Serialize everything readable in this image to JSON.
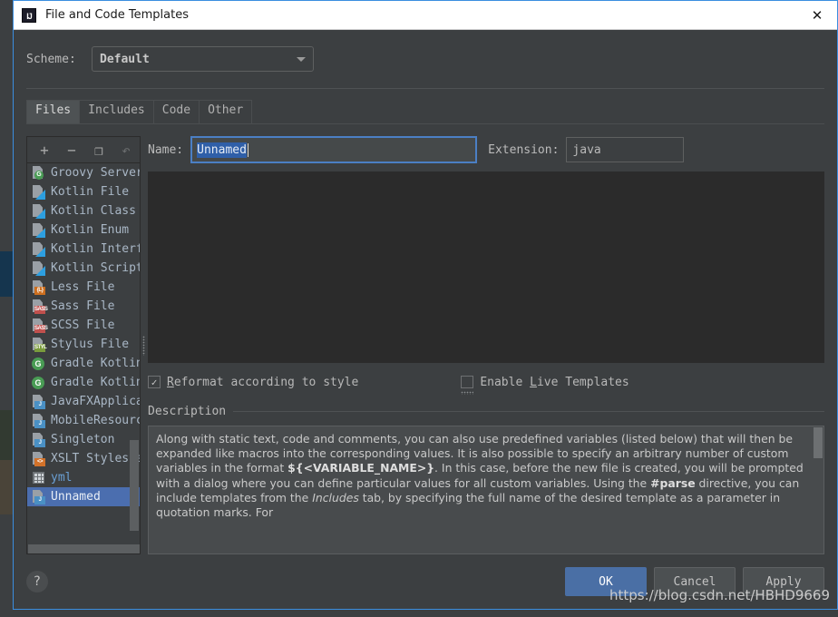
{
  "window": {
    "title": "File and Code Templates",
    "logo_text": "IJ",
    "close_icon": "close-icon"
  },
  "scheme": {
    "label": "Scheme:",
    "value": "Default",
    "caret_icon": "chevron-down-icon"
  },
  "tabs": [
    {
      "label": "Files",
      "active": true
    },
    {
      "label": "Includes",
      "active": false
    },
    {
      "label": "Code",
      "active": false
    },
    {
      "label": "Other",
      "active": false
    }
  ],
  "toolbar": [
    {
      "name": "add-button",
      "glyph": "+",
      "disabled": false
    },
    {
      "name": "remove-button",
      "glyph": "−",
      "disabled": false
    },
    {
      "name": "copy-button",
      "glyph": "❐",
      "disabled": false
    },
    {
      "name": "reset-button",
      "glyph": "↶",
      "disabled": true
    }
  ],
  "template_list": {
    "items": [
      {
        "label": "Groovy Server Page",
        "icon": "groovy-file-icon",
        "kind": "circle",
        "badge": "G",
        "color": "#499c54"
      },
      {
        "label": "Kotlin File",
        "icon": "kotlin-file-icon",
        "kind": "kotlin"
      },
      {
        "label": "Kotlin Class",
        "icon": "kotlin-file-icon",
        "kind": "kotlin"
      },
      {
        "label": "Kotlin Enum",
        "icon": "kotlin-file-icon",
        "kind": "kotlin"
      },
      {
        "label": "Kotlin Interface",
        "icon": "kotlin-file-icon",
        "kind": "kotlin"
      },
      {
        "label": "Kotlin Script",
        "icon": "kotlin-file-icon",
        "kind": "kotlin"
      },
      {
        "label": "Less File",
        "icon": "less-file-icon",
        "kind": "badge",
        "badge": "{L}",
        "color": "#cd6f1f"
      },
      {
        "label": "Sass File",
        "icon": "sass-file-icon",
        "kind": "badge",
        "badge": "SASS",
        "color": "#c0504d"
      },
      {
        "label": "SCSS File",
        "icon": "scss-file-icon",
        "kind": "badge",
        "badge": "SASS",
        "color": "#c0504d"
      },
      {
        "label": "Stylus File",
        "icon": "stylus-file-icon",
        "kind": "badge",
        "badge": "STYL",
        "color": "#7a9b3c"
      },
      {
        "label": "Gradle Kotlin DSL Build Scri",
        "icon": "gradle-icon",
        "kind": "circle",
        "badge": "G",
        "color": "#499c54"
      },
      {
        "label": "Gradle Kotlin DSL Settings",
        "icon": "gradle-icon",
        "kind": "circle",
        "badge": "G",
        "color": "#499c54"
      },
      {
        "label": "JavaFXApplication",
        "icon": "java-file-icon",
        "kind": "badge",
        "badge": "J",
        "color": "#4a90c4"
      },
      {
        "label": "MobileResourceBundle",
        "icon": "java-file-icon",
        "kind": "badge",
        "badge": "J",
        "color": "#4a90c4"
      },
      {
        "label": "Singleton",
        "icon": "java-file-icon",
        "kind": "badge",
        "badge": "J",
        "color": "#4a90c4"
      },
      {
        "label": "XSLT Stylesheet",
        "icon": "xslt-file-icon",
        "kind": "badge",
        "badge": "<>",
        "color": "#d2722a"
      },
      {
        "label": "yml",
        "icon": "yaml-file-icon",
        "kind": "table",
        "text_color": "#6a9fd4"
      },
      {
        "label": "Unnamed",
        "icon": "java-file-icon",
        "kind": "badge",
        "badge": "J",
        "color": "#4a90c4",
        "selected": true
      }
    ]
  },
  "name_field": {
    "label": "Name:",
    "value": "Unnamed",
    "selected": true
  },
  "extension_field": {
    "label": "Extension:",
    "value": "java"
  },
  "editor": {
    "content": ""
  },
  "checkboxes": {
    "reformat": {
      "label": "Reformat according to style",
      "mnemonic": "R",
      "checked": true,
      "check_glyph": "✓"
    },
    "live_templates": {
      "label": "Enable Live Templates",
      "mnemonic": "L",
      "checked": false,
      "focused": true
    }
  },
  "description": {
    "header": "Description",
    "paragraph_1": "Along with static text, code and comments, you can also use predefined variables (listed below) that will then be expanded like macros into the corresponding values. It is also possible to specify an arbitrary number of custom variables in the format ",
    "code_1": "${<VARIABLE_NAME>}",
    "paragraph_2": ". In this case, before the new file is created, you will be prompted with a dialog where you can define particular values for all custom variables. Using the ",
    "code_2": "#parse",
    "paragraph_3": " directive, you can include templates from the ",
    "italic_1": "Includes",
    "paragraph_4": " tab, by specifying the full name of the desired template as a parameter in quotation marks. For"
  },
  "footer": {
    "help_label": "?",
    "buttons": [
      {
        "label": "OK",
        "primary": true
      },
      {
        "label": "Cancel",
        "primary": false
      },
      {
        "label": "Apply",
        "primary": false
      }
    ]
  },
  "watermark": "https://blog.csdn.net/HBHD9669"
}
